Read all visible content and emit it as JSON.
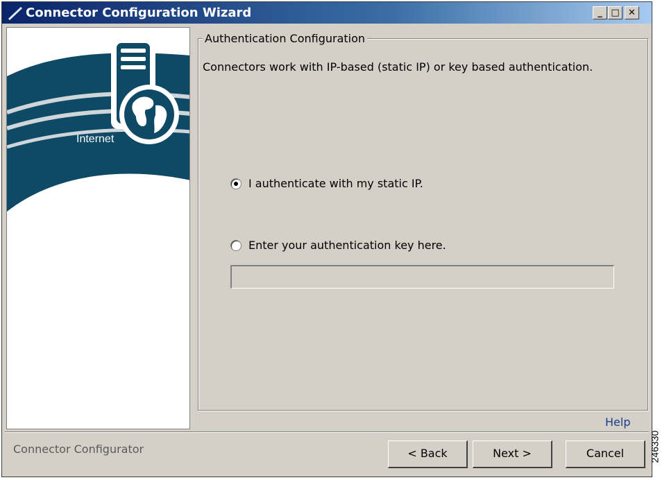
{
  "window": {
    "title": "Connector Configuration Wizard",
    "controls": {
      "minimize": "_",
      "maximize": "□",
      "close": "✕"
    }
  },
  "sidebar": {
    "illustration": "internet-globe-server-icon",
    "label": "Internet"
  },
  "auth": {
    "group_title": "Authentication Configuration",
    "description": "Connectors work with IP-based (static IP) or key based authentication.",
    "options": [
      {
        "label": "I authenticate with my static IP.",
        "selected": true
      },
      {
        "label": "Enter your authentication key here.",
        "selected": false
      }
    ],
    "key_value": ""
  },
  "footer": {
    "help": "Help",
    "status": "Connector Configurator",
    "back": "< Back",
    "next": "Next >",
    "cancel": "Cancel"
  },
  "figure_id": "246330",
  "colors": {
    "title_start": "#0a246a",
    "title_end": "#a6caf0",
    "dialog_bg": "#d4d0c8",
    "arc": "#0e4a66",
    "link": "#1a3c8c"
  }
}
